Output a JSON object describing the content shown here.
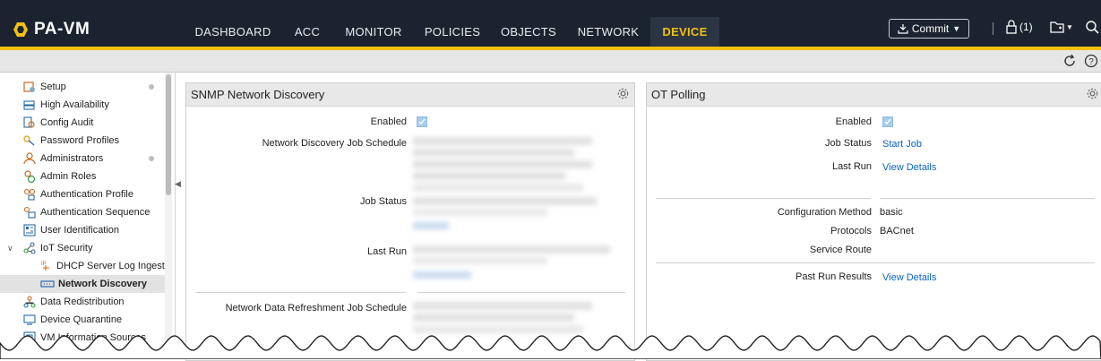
{
  "header": {
    "logo_text": "PA-VM",
    "nav_tabs": [
      {
        "label": "DASHBOARD",
        "active": false
      },
      {
        "label": "ACC",
        "active": false
      },
      {
        "label": "MONITOR",
        "active": false
      },
      {
        "label": "POLICIES",
        "active": false
      },
      {
        "label": "OBJECTS",
        "active": false
      },
      {
        "label": "NETWORK",
        "active": false
      },
      {
        "label": "DEVICE",
        "active": true
      }
    ],
    "commit_label": "Commit",
    "lock_count": "(1)",
    "accent_color": "#f2c011",
    "bar_color": "#1b2330"
  },
  "sidebar": {
    "items": [
      {
        "label": "Setup",
        "icon": "setup-icon",
        "dot": true
      },
      {
        "label": "High Availability",
        "icon": "high-availability-icon"
      },
      {
        "label": "Config Audit",
        "icon": "config-audit-icon"
      },
      {
        "label": "Password Profiles",
        "icon": "password-profiles-icon"
      },
      {
        "label": "Administrators",
        "icon": "administrators-icon",
        "dot": true
      },
      {
        "label": "Admin Roles",
        "icon": "admin-roles-icon"
      },
      {
        "label": "Authentication Profile",
        "icon": "authentication-profile-icon"
      },
      {
        "label": "Authentication Sequence",
        "icon": "authentication-sequence-icon"
      },
      {
        "label": "User Identification",
        "icon": "user-identification-icon"
      },
      {
        "label": "IoT Security",
        "icon": "iot-security-icon",
        "expanded": true
      },
      {
        "label": "DHCP Server Log Ingest",
        "icon": "dhcp-server-log-icon"
      },
      {
        "label": "Network Discovery",
        "icon": "network-discovery-icon",
        "selected": true
      },
      {
        "label": "Data Redistribution",
        "icon": "data-redistribution-icon"
      },
      {
        "label": "Device Quarantine",
        "icon": "device-quarantine-icon"
      },
      {
        "label": "VM Information Sources",
        "icon": "vm-information-sources-icon"
      }
    ]
  },
  "snmp_panel": {
    "title": "SNMP Network Discovery",
    "fields": {
      "enabled": "Enabled",
      "schedule": "Network Discovery Job Schedule",
      "job_status": "Job Status",
      "last_run": "Last Run",
      "refresh_schedule": "Network Data Refreshment Job Schedule"
    },
    "enabled_checked": true
  },
  "ot_panel": {
    "title": "OT Polling",
    "fields": {
      "enabled": "Enabled",
      "job_status": "Job Status",
      "last_run": "Last Run",
      "config_method": "Configuration Method",
      "protocols": "Protocols",
      "service_route": "Service Route",
      "past_results": "Past Run Results"
    },
    "values": {
      "job_status": "Start Job",
      "last_run": "View Details",
      "config_method": "basic",
      "protocols": "BACnet",
      "past_results": "View Details"
    },
    "enabled_checked": true
  }
}
